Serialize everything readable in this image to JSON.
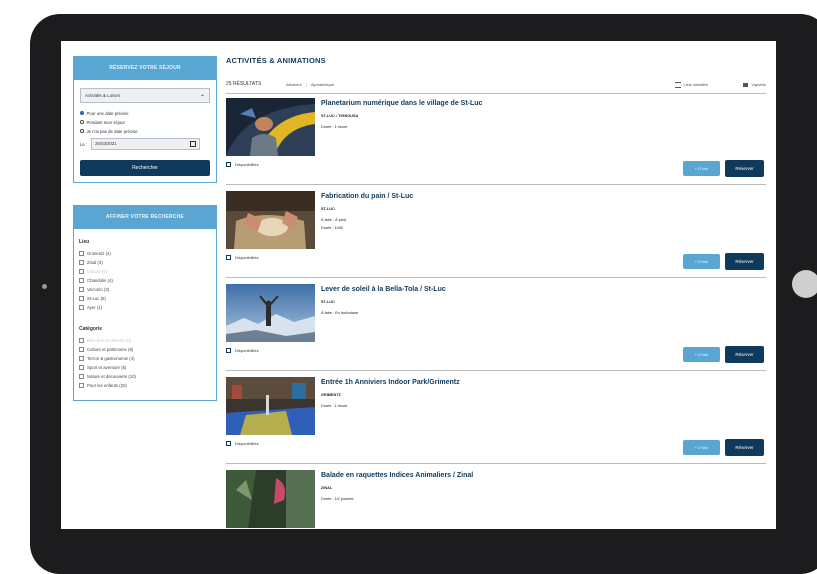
{
  "search_box": {
    "header": "RÉSERVEZ VOTRE SÉJOUR",
    "select_value": "Activités & Loisirs",
    "radios": [
      {
        "label": "Pour une date précise",
        "selected": true
      },
      {
        "label": "Pendant mon séjour",
        "selected": false
      },
      {
        "label": "Je n'ai pas de date précise",
        "selected": false
      }
    ],
    "date_label": "Le :",
    "date_value": "26/03/2021",
    "search_button": "Rechercher"
  },
  "refine_box": {
    "header": "AFFINER VOTRE RECHERCHE",
    "groups": [
      {
        "title": "Lieu",
        "items": [
          {
            "label": "Grimentz (4)",
            "dim": false
          },
          {
            "label": "Zinal (3)",
            "dim": false
          },
          {
            "label": "Vissoie (0)",
            "dim": true
          },
          {
            "label": "Chandolin (4)",
            "dim": false
          },
          {
            "label": "Vercorin (3)",
            "dim": false
          },
          {
            "label": "St-Luc (5)",
            "dim": false
          },
          {
            "label": "Ayer (1)",
            "dim": false
          }
        ]
      },
      {
        "title": "Catégorie",
        "items": [
          {
            "label": "Bien-être et détente (0)",
            "dim": true
          },
          {
            "label": "Culture et patrimoine (8)",
            "dim": false
          },
          {
            "label": "Terroir & gastronomie (4)",
            "dim": false
          },
          {
            "label": "Sport et aventure (5)",
            "dim": false
          },
          {
            "label": "Nature et découverte (10)",
            "dim": false
          },
          {
            "label": "Pour les enfants (20)",
            "dim": false
          }
        ]
      }
    ]
  },
  "main": {
    "title": "ACTIVITÉS & ANIMATIONS",
    "results_count": "25 RÉSULTATS",
    "sort_random": "Aléatoire",
    "sort_alpha": "Alphabétique",
    "view_list": "Liste détaillée",
    "view_grid": "Vignette",
    "items": [
      {
        "title": "Planetarium numérique dans le village de St-Luc",
        "meta": "ST-LUC  •  TIGNOUSA",
        "line1": "Durée : 1 heure",
        "line2": "",
        "availability": "Disponibilités",
        "info_button": "+ D'info",
        "book_button": "Réserver"
      },
      {
        "title": "Fabrication du pain / St-Luc",
        "meta": "ST-LUC",
        "line1": "À faire : À pied",
        "line2": "Durée : 1h30",
        "availability": "Disponibilités",
        "info_button": "+ D'info",
        "book_button": "Réserver"
      },
      {
        "title": "Lever de soleil à la Bella-Tola / St-Luc",
        "meta": "ST-LUC",
        "line1": "À faire : En funiculaire",
        "line2": "",
        "availability": "Disponibilités",
        "info_button": "+ D'info",
        "book_button": "Réserver"
      },
      {
        "title": "Entrée 1h Anniviers Indoor Park/Grimentz",
        "meta": "GRIMENTZ",
        "line1": "Durée : 1 heure",
        "line2": "",
        "availability": "Disponibilités",
        "info_button": "+ D'info",
        "book_button": "Réserver"
      },
      {
        "title": "Balade en raquettes Indices Animaliers / Zinal",
        "meta": "ZINAL",
        "line1": "Durée : 1/2 journée",
        "line2": "",
        "availability": "",
        "info_button": "",
        "book_button": ""
      }
    ]
  }
}
